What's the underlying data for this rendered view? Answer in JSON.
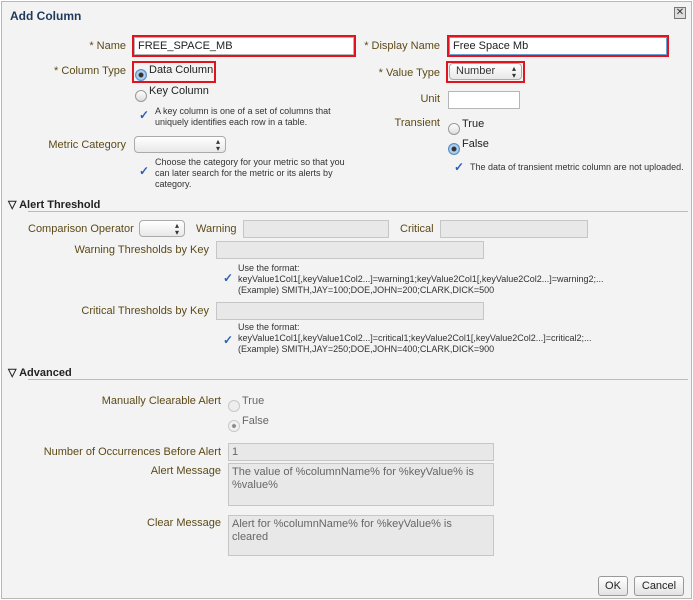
{
  "title": "Add Column",
  "name": {
    "label": "* Name",
    "value": "FREE_SPACE_MB"
  },
  "display_name": {
    "label": "* Display Name",
    "value": "Free Space Mb"
  },
  "column_type": {
    "label": "* Column Type",
    "options": [
      "Data Column",
      "Key Column"
    ],
    "selected": "Data Column",
    "hint": [
      "A key column is one of a set of columns that",
      "uniquely identifies each row in a table."
    ]
  },
  "value_type": {
    "label": "* Value Type",
    "value": "Number"
  },
  "unit": {
    "label": "Unit",
    "value": ""
  },
  "transient": {
    "label": "Transient",
    "options": [
      "True",
      "False"
    ],
    "selected": "False",
    "hint": "The data of transient metric column are not uploaded."
  },
  "metric_category": {
    "label": "Metric Category",
    "value": "",
    "hint": [
      "Choose the category for your metric so that you",
      "can later search for the metric or its alerts by",
      "category."
    ]
  },
  "alert": {
    "title": "Alert Threshold",
    "comparison_label": "Comparison Operator",
    "warning_label": "Warning",
    "critical_label": "Critical",
    "warning_key_label": "Warning Thresholds by Key",
    "warning_hint": [
      "Use the format:",
      "keyValue1Col1[,keyValue1Col2...]=warning1;keyValue2Col1[,keyValue2Col2...]=warning2;...",
      "(Example) SMITH,JAY=100;DOE,JOHN=200;CLARK,DICK=500"
    ],
    "critical_key_label": "Critical Thresholds by Key",
    "critical_hint": [
      "Use the format:",
      "keyValue1Col1[,keyValue1Col2...]=critical1;keyValue2Col1[,keyValue2Col2...]=critical2;...",
      "(Example) SMITH,JAY=250;DOE,JOHN=400;CLARK,DICK=900"
    ]
  },
  "advanced": {
    "title": "Advanced",
    "clearable_label": "Manually Clearable Alert",
    "clearable_options": [
      "True",
      "False"
    ],
    "clearable_selected": "False",
    "occurrences_label": "Number of Occurrences Before Alert",
    "occurrences_value": "1",
    "alert_msg_label": "Alert Message",
    "alert_msg_value": "The value of %columnName% for %keyValue% is %value%",
    "clear_msg_label": "Clear Message",
    "clear_msg_value": "Alert for %columnName% for %keyValue% is cleared"
  },
  "buttons": {
    "ok": "OK",
    "cancel": "Cancel"
  }
}
